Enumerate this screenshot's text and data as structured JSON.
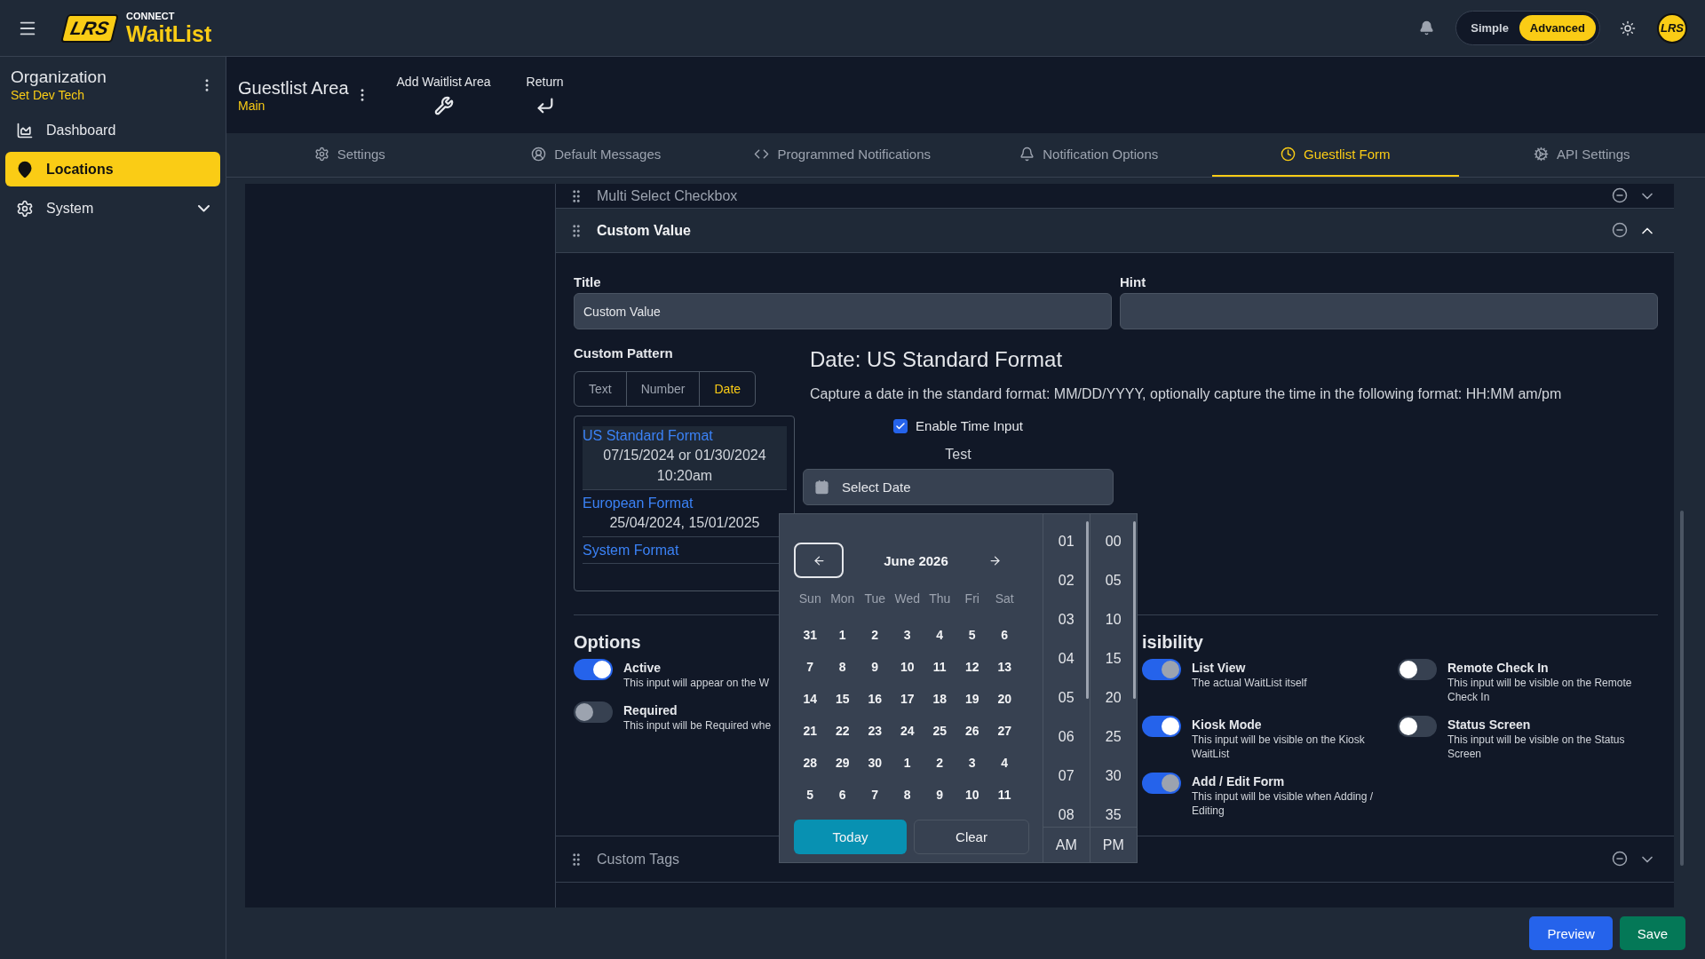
{
  "app": {
    "logo_mark": "LRS",
    "brand_small": "CONNECT",
    "brand": "WaitList",
    "mode_toggle": [
      {
        "label": "Simple",
        "selected": false
      },
      {
        "label": "Advanced",
        "selected": true
      }
    ],
    "avatar": "LRS"
  },
  "sidebar": {
    "org_title": "Organization",
    "org_name": "Set Dev Tech",
    "items": [
      {
        "label": "Dashboard",
        "selected": false,
        "expandable": false
      },
      {
        "label": "Locations",
        "selected": true,
        "expandable": false
      },
      {
        "label": "System",
        "selected": false,
        "expandable": true
      }
    ]
  },
  "header": {
    "title": "Guestlist Area",
    "subtitle": "Main",
    "actions": [
      "Add Waitlist Area",
      "Return"
    ]
  },
  "tabs": [
    {
      "label": "Settings",
      "selected": false
    },
    {
      "label": "Default Messages",
      "selected": false
    },
    {
      "label": "Programmed Notifications",
      "selected": false
    },
    {
      "label": "Notification Options",
      "selected": false
    },
    {
      "label": "Guestlist Form",
      "selected": true
    },
    {
      "label": "API Settings",
      "selected": false
    }
  ],
  "sections": [
    {
      "title": "Multi Select Checkbox",
      "expanded": false
    },
    {
      "title": "Custom Value",
      "expanded": true
    },
    {
      "title": "Custom Tags",
      "expanded": false
    }
  ],
  "custom_value": {
    "title_label": "Title",
    "title_value": "Custom Value",
    "hint_label": "Hint",
    "pattern_label": "Custom Pattern",
    "pattern_types": [
      {
        "label": "Text",
        "selected": false
      },
      {
        "label": "Number",
        "selected": false
      },
      {
        "label": "Date",
        "selected": true
      }
    ],
    "formats": [
      {
        "name": "US Standard Format",
        "example": "07/15/2024 or 01/30/2024 10:20am",
        "selected": true
      },
      {
        "name": "European Format",
        "example": "25/04/2024, 15/01/2025",
        "selected": false
      },
      {
        "name": "System Format",
        "selected": false
      }
    ],
    "format_heading": "Date: US Standard Format",
    "format_description": "Capture a date in the standard format: MM/DD/YYYY, optionally capture the time in the following format: HH:MM am/pm",
    "enable_time": {
      "label": "Enable Time Input",
      "checked": true
    },
    "test_label": "Test",
    "date_field": {
      "placeholder": "Select Date"
    },
    "date_picker": {
      "month": "June 2026",
      "weekdays": [
        "Sun",
        "Mon",
        "Tue",
        "Wed",
        "Thu",
        "Fri",
        "Sat"
      ],
      "weeks": [
        [
          "31",
          "1",
          "2",
          "3",
          "4",
          "5",
          "6"
        ],
        [
          "7",
          "8",
          "9",
          "10",
          "11",
          "12",
          "13"
        ],
        [
          "14",
          "15",
          "16",
          "17",
          "18",
          "19",
          "20"
        ],
        [
          "21",
          "22",
          "23",
          "24",
          "25",
          "26",
          "27"
        ],
        [
          "28",
          "29",
          "30",
          "1",
          "2",
          "3",
          "4"
        ],
        [
          "5",
          "6",
          "7",
          "8",
          "9",
          "10",
          "11"
        ]
      ],
      "today": "Today",
      "clear": "Clear",
      "hours": [
        "01",
        "02",
        "03",
        "04",
        "05",
        "06",
        "07",
        "08"
      ],
      "minutes": [
        "00",
        "05",
        "10",
        "15",
        "20",
        "25",
        "30",
        "35"
      ],
      "meridiem": [
        "AM",
        "PM"
      ]
    },
    "options_title": "Options",
    "options": [
      {
        "label": "Active",
        "description": "This input will appear on the W",
        "on": true,
        "disabled": false
      },
      {
        "label": "Required",
        "description": "This input will be Required whe",
        "on": false,
        "disabled": true
      }
    ],
    "visibility_title": "isibility",
    "visibility": [
      {
        "label": "List View",
        "description": "The actual WaitList itself",
        "on": true,
        "disabled": true
      },
      {
        "label": "Remote Check In",
        "description": "This input will be visible on the Remote Check In",
        "on": false,
        "disabled": false
      },
      {
        "label": "Kiosk Mode",
        "description": "This input will be visible on the Kiosk WaitList",
        "on": true,
        "disabled": false
      },
      {
        "label": "Status Screen",
        "description": "This input will be visible on the Status Screen",
        "on": false,
        "disabled": false
      },
      {
        "label": "Add / Edit Form",
        "description": "This input will be visible when Adding / Editing",
        "on": true,
        "disabled": true
      }
    ]
  },
  "footer": {
    "buttons": [
      {
        "label": "Preview",
        "kind": "primary"
      },
      {
        "label": "Save",
        "kind": "success"
      }
    ]
  }
}
